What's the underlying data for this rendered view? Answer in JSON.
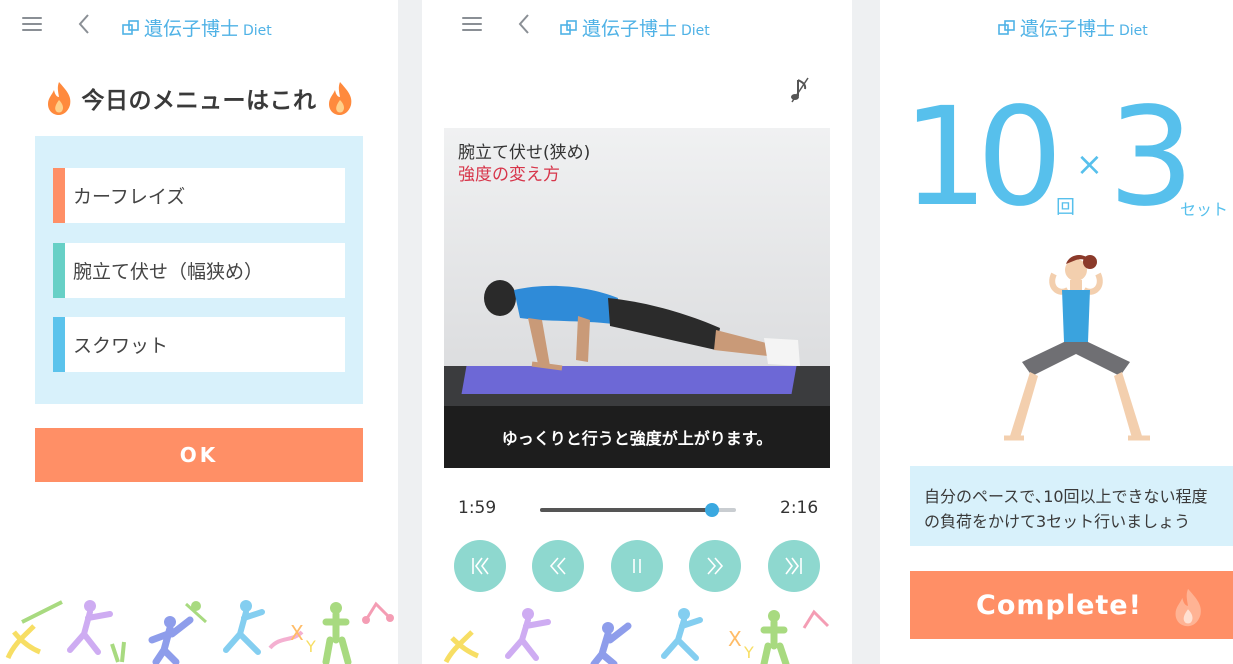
{
  "app": {
    "logo_title": "遺伝子博士",
    "logo_sub": "Diet",
    "icons": {
      "menu": "hamburger-menu-icon",
      "back": "chevron-left-icon",
      "logo": "dna-tile-logo-icon"
    },
    "colors": {
      "accent_blue": "#4fb2e6",
      "accent_orange": "#ff8f66",
      "light_blue_bg": "#d8f1fb",
      "teal": "#8ed8cf"
    }
  },
  "menu_screen": {
    "heading": "今日のメニューはこれ",
    "items": [
      {
        "label": "カーフレイズ",
        "color": "#ff8f66"
      },
      {
        "label": "腕立て伏せ（幅狭め）",
        "color": "#67d0c6"
      },
      {
        "label": "スクワット",
        "color": "#5bc3ec"
      }
    ],
    "ok_label": "OK"
  },
  "video_screen": {
    "title": "腕立て伏せ(狭め)",
    "subtitle": "強度の変え方",
    "caption": "ゆっくりと行うと強度が上がります。",
    "current_time": "1:59",
    "duration": "2:16",
    "progress": 0.876,
    "controls": [
      {
        "name": "skip-to-start",
        "icon": "skip-previous-icon"
      },
      {
        "name": "rewind",
        "icon": "rewind-icon"
      },
      {
        "name": "pause",
        "icon": "pause-icon"
      },
      {
        "name": "fast-forward",
        "icon": "fast-forward-icon"
      },
      {
        "name": "skip-to-end",
        "icon": "skip-next-icon"
      }
    ],
    "music_icon": "music-note-off-icon"
  },
  "complete_screen": {
    "reps_number": "10",
    "reps_unit": "回",
    "times_symbol": "×",
    "sets_number": "3",
    "sets_unit": "セット",
    "description_line1": "自分のペースで､10回以上できない程度",
    "description_line2": "の負荷をかけて3セット行いましょう",
    "complete_label": "Complete!"
  }
}
